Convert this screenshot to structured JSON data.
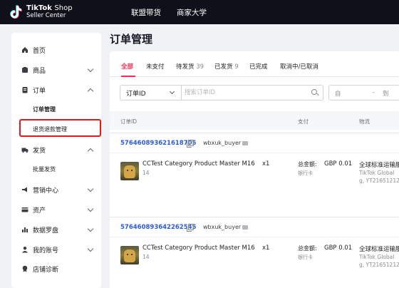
{
  "topbar": {
    "logo_line1_bold": "TikTok",
    "logo_line1_light": "Shop",
    "logo_line2": "Seller Center",
    "nav": [
      "联盟带货",
      "商家大学"
    ]
  },
  "sidebar": {
    "items": [
      {
        "label": "首页",
        "icon": "home-icon"
      },
      {
        "label": "商品",
        "icon": "product-icon"
      },
      {
        "label": "订单",
        "icon": "order-icon"
      },
      {
        "label": "发货",
        "icon": "truck-icon"
      },
      {
        "label": "营销中心",
        "icon": "megaphone-icon"
      },
      {
        "label": "资产",
        "icon": "card-icon"
      },
      {
        "label": "数据罗盘",
        "icon": "chart-icon"
      },
      {
        "label": "我的账号",
        "icon": "user-icon"
      },
      {
        "label": "店铺诊断",
        "icon": "badge-icon"
      }
    ],
    "order_subitems": [
      "订单管理",
      "退货退款管理"
    ],
    "shipping_subitems": [
      "批量发货"
    ]
  },
  "page_title": "订单管理",
  "tabs": [
    {
      "label": "全部",
      "count": ""
    },
    {
      "label": "未支付",
      "count": ""
    },
    {
      "label": "待发货",
      "count": "39"
    },
    {
      "label": "已发货",
      "count": "9"
    },
    {
      "label": "已完成",
      "count": ""
    },
    {
      "label": "取消中/已取消",
      "count": ""
    }
  ],
  "filter": {
    "select_value": "订单ID",
    "search_placeholder": "搜索订单ID",
    "date_start": "自",
    "date_sep": "-",
    "date_end": "到"
  },
  "table_headers": {
    "order_id": "订单ID",
    "payment": "支付",
    "logistics": "物流"
  },
  "orders": [
    {
      "id": "576460893621618705",
      "buyer": "wbxuk_buyer",
      "product": "CCTest Category Product Master M16",
      "product_sub": "14",
      "qty": "x1",
      "total_label": "总金额:",
      "total": "GBP 0.01",
      "pay_method": "银行卡",
      "ship_line1": "全球标准运输服",
      "ship_line2": "TikTok Global",
      "ship_line3": "g, YT21651212"
    },
    {
      "id": "576460893642262545",
      "buyer": "wbxuk_buyer",
      "product": "CCTest Category Product Master M16",
      "product_sub": "14",
      "qty": "x1",
      "total_label": "总金额:",
      "total": "GBP 0.01",
      "pay_method": "银行卡",
      "ship_line1": "全球标准运输服",
      "ship_line2": "TikTok Global",
      "ship_line3": "g, YT21651212"
    }
  ],
  "colors": {
    "topbar_bg": "#0f1019",
    "accent": "#fe2c55",
    "link": "#2a5bd7",
    "highlight_box": "#e5181b"
  }
}
